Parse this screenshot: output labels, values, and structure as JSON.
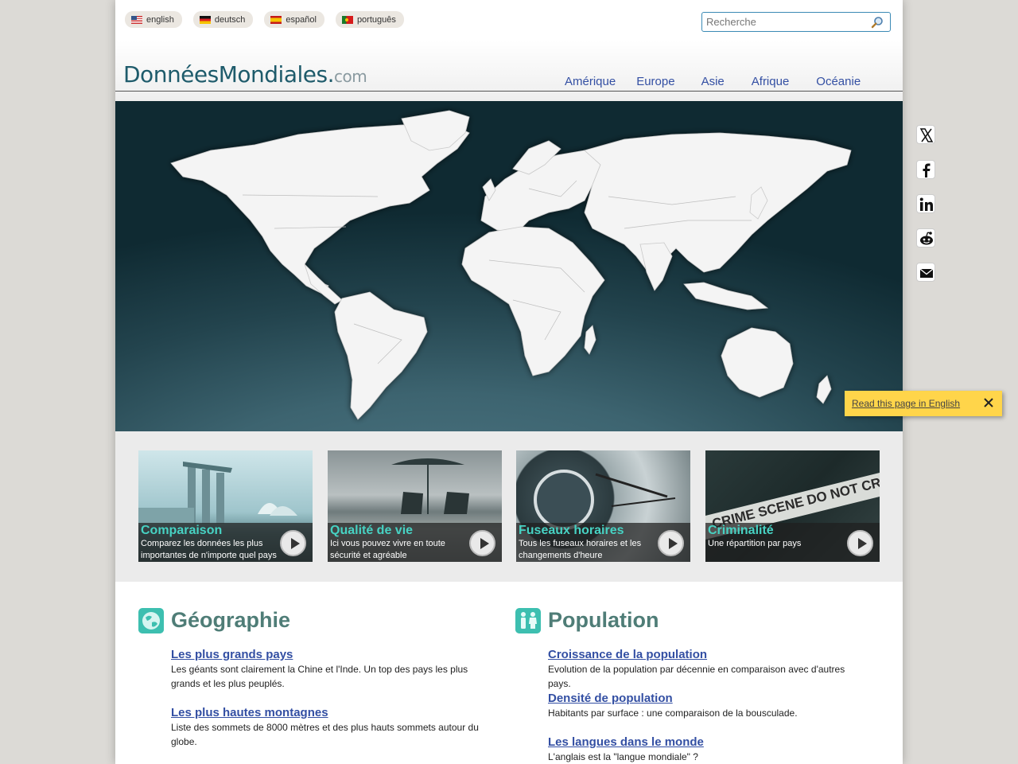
{
  "languages": [
    {
      "label": "english",
      "flag": "us-flag-icon"
    },
    {
      "label": "deutsch",
      "flag": "germany-flag-icon"
    },
    {
      "label": "español",
      "flag": "spain-flag-icon"
    },
    {
      "label": "português",
      "flag": "portugal-flag-icon"
    }
  ],
  "search": {
    "placeholder": "Recherche",
    "value": ""
  },
  "logo": {
    "main": "DonnéesMondiales",
    "dot": ".",
    "suffix": "com"
  },
  "nav": [
    "Amérique",
    "Europe",
    "Asie",
    "Afrique",
    "Océanie"
  ],
  "tiles": [
    {
      "title": "Comparaison",
      "desc": "Comparez les données les plus importantes de n'importe quel pays"
    },
    {
      "title": "Qualité de vie",
      "desc": "Ici vous pouvez vivre en toute sécurité et agréable"
    },
    {
      "title": "Fuseaux horaires",
      "desc": "Tous les fuseaux horaires et les changements d'heure"
    },
    {
      "title": "Criminalité",
      "desc": "Une répartition par pays"
    }
  ],
  "crime_tape_text": "CRIME SCENE DO NOT CROSS",
  "geography": {
    "title": "Géographie",
    "items": [
      {
        "link": "Les plus grands pays",
        "desc": "Les géants sont clairement la Chine et l'Inde. Un top des pays les plus grands et les plus peuplés."
      },
      {
        "link": "Les plus hautes montagnes",
        "desc": "Liste des sommets de 8000 mètres et des plus hauts sommets autour du globe."
      }
    ]
  },
  "population": {
    "title": "Population",
    "items": [
      {
        "link": "Croissance de la population",
        "desc": "Evolution de la population par décennie en comparaison avec d'autres pays."
      },
      {
        "link": "Densité de population",
        "desc": "Habitants par surface : une comparaison de la bousculade."
      },
      {
        "link": "Les langues dans le monde",
        "desc": "L'anglais est la \"langue mondiale\" ?"
      }
    ]
  },
  "social": [
    "x-icon",
    "facebook-icon",
    "linkedin-icon",
    "reddit-icon",
    "email-icon"
  ],
  "popup": {
    "link": "Read this page in English"
  },
  "colors": {
    "accent_teal": "#47d2c3",
    "link_blue": "#334fa3",
    "section_title": "#4f7d77",
    "popup_yellow": "#ffd54a"
  }
}
